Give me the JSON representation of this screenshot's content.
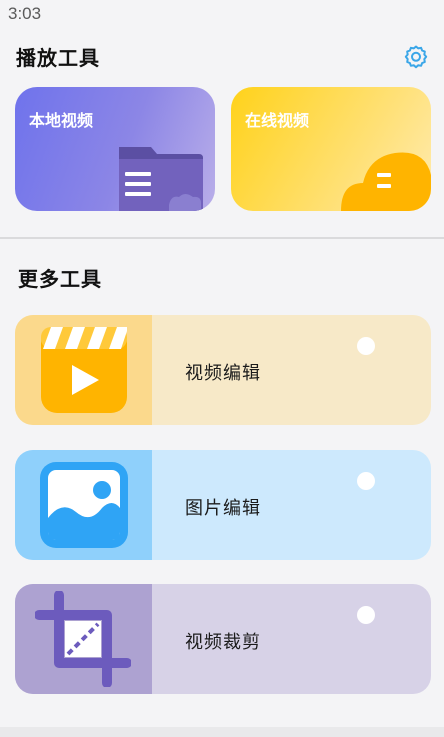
{
  "status_bar": {
    "time": "3:03"
  },
  "play_tools": {
    "title": "播放工具",
    "settings_icon": "gear-icon",
    "cards": [
      {
        "label": "本地视频",
        "icon": "folder-icon",
        "color_start": "#6f73ec",
        "color_end": "#b9aee9"
      },
      {
        "label": "在线视频",
        "icon": "cloud-icon",
        "color_start": "#ffd21a",
        "color_end": "#ffebb1"
      }
    ]
  },
  "more_tools": {
    "title": "更多工具",
    "items": [
      {
        "label": "视频编辑",
        "icon": "video-clapper-icon",
        "bg": "#f7e9c8",
        "icon_bg": "#fbd98c"
      },
      {
        "label": "图片编辑",
        "icon": "image-icon",
        "bg": "#cde9fd",
        "icon_bg": "#8fd0fb"
      },
      {
        "label": "视频裁剪",
        "icon": "crop-icon",
        "bg": "#d7d2e7",
        "icon_bg": "#ada2d1"
      }
    ]
  },
  "accent_color": "#3aa6e8"
}
